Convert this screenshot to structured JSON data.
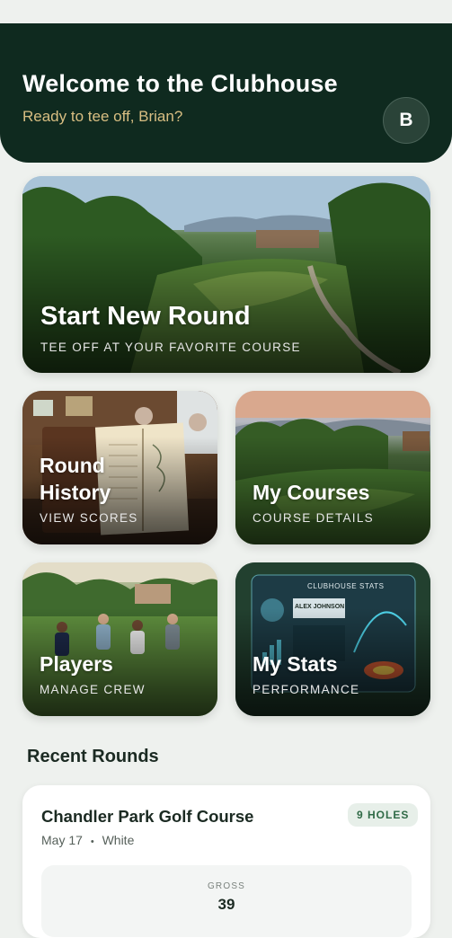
{
  "header": {
    "title": "Welcome to the Clubhouse",
    "greeting": "Ready to tee off, Brian?",
    "avatar_initial": "B"
  },
  "cards": {
    "start_round": {
      "title": "Start New Round",
      "subtitle": "TEE OFF AT YOUR FAVORITE COURSE"
    },
    "round_history": {
      "title_line1": "Round",
      "title_line2": "History",
      "subtitle": "VIEW SCORES"
    },
    "my_courses": {
      "title": "My Courses",
      "subtitle": "COURSE DETAILS"
    },
    "players": {
      "title": "Players",
      "subtitle": "MANAGE CREW"
    },
    "my_stats": {
      "title": "My Stats",
      "subtitle": "PERFORMANCE",
      "screen_title": "CLUBHOUSE STATS",
      "screen_player": "ALEX JOHNSON"
    }
  },
  "recent_rounds": {
    "heading": "Recent Rounds",
    "items": [
      {
        "course": "Chandler Park Golf Course",
        "date": "May 17",
        "tee": "White",
        "separator": "•",
        "holes": "9 HOLES",
        "gross_label": "GROSS",
        "gross": "39"
      }
    ]
  },
  "colors": {
    "header_bg": "#0f2a1f",
    "greeting": "#d8be82",
    "page_bg": "#eef1ee",
    "badge_text": "#2f6a46"
  }
}
